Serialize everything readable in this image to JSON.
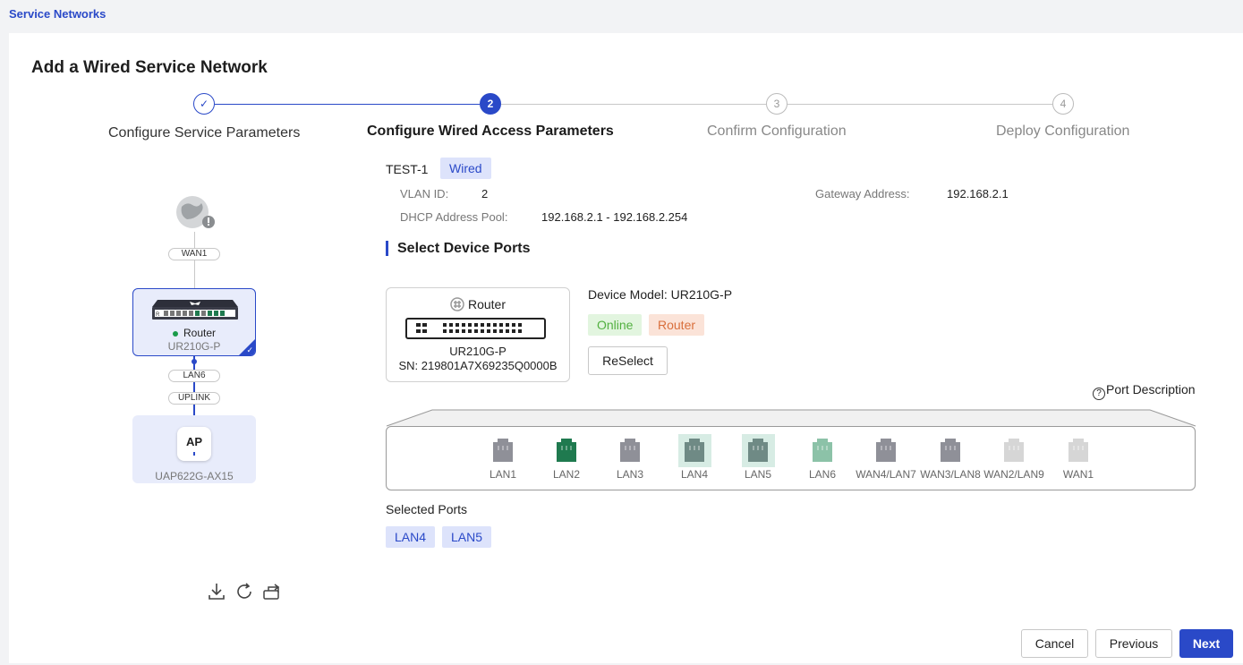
{
  "breadcrumb": "Service Networks",
  "title": "Add a Wired Service Network",
  "steps": [
    {
      "num": "✓",
      "label": "Configure Service Parameters"
    },
    {
      "num": "2",
      "label": "Configure Wired Access Parameters"
    },
    {
      "num": "3",
      "label": "Confirm Configuration"
    },
    {
      "num": "4",
      "label": "Deploy Configuration"
    }
  ],
  "topology": {
    "wan_pill": "WAN1",
    "lan_pill": "LAN6",
    "uplink_pill": "UPLINK",
    "router": {
      "name": "Router",
      "model": "UR210G-P",
      "status_color": "#1a9b4a"
    },
    "ap": {
      "icon_text": "AP",
      "model": "UAP622G-AX15"
    },
    "tools": [
      "download-icon",
      "refresh-icon",
      "switch-view-icon"
    ]
  },
  "network": {
    "name": "TEST-1",
    "type_tag": "Wired",
    "vlan_label": "VLAN ID:",
    "vlan_value": "2",
    "gateway_label": "Gateway Address:",
    "gateway_value": "192.168.2.1",
    "dhcp_label": "DHCP Address Pool:",
    "dhcp_value": "192.168.2.1 - 192.168.2.254"
  },
  "section_title": "Select Device Ports",
  "device": {
    "type": "Router",
    "model": "UR210G-P",
    "sn": "SN: 219801A7X69235Q0000B",
    "model_line": "Device Model: UR210G-P",
    "status_tag": "Online",
    "role_tag": "Router",
    "reselect": "ReSelect"
  },
  "port_desc": "Port Description",
  "ports": [
    {
      "label": "LAN1",
      "color": "#8f9098",
      "selected": false
    },
    {
      "label": "LAN2",
      "color": "#1f7a4f",
      "selected": false
    },
    {
      "label": "LAN3",
      "color": "#8f9098",
      "selected": false
    },
    {
      "label": "LAN4",
      "color": "#6f8a85",
      "selected": true
    },
    {
      "label": "LAN5",
      "color": "#6f8a85",
      "selected": true
    },
    {
      "label": "LAN6",
      "color": "#8cc2a8",
      "selected": false
    },
    {
      "label": "WAN4/LAN7",
      "color": "#8f9098",
      "selected": false
    },
    {
      "label": "WAN3/LAN8",
      "color": "#8f9098",
      "selected": false
    },
    {
      "label": "WAN2/LAN9",
      "color": "#d6d6d6",
      "selected": false
    },
    {
      "label": "WAN1",
      "color": "#d6d6d6",
      "selected": false
    }
  ],
  "selected_ports_label": "Selected Ports",
  "selected_ports": [
    "LAN4",
    "LAN5"
  ],
  "footer": {
    "cancel": "Cancel",
    "previous": "Previous",
    "next": "Next"
  },
  "colors": {
    "accent": "#2a49c8",
    "online": "#52b040",
    "router_tag": "#d96f3c"
  }
}
